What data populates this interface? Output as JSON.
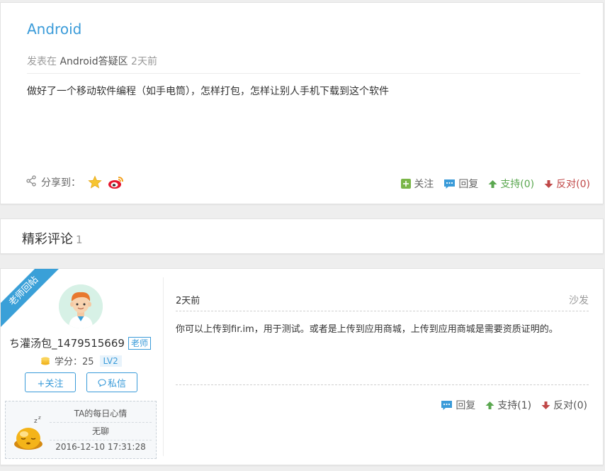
{
  "question": {
    "title": "Android",
    "meta_prefix": "发表在",
    "meta_category": "Android答疑区",
    "meta_time": "2天前",
    "body": "做好了一个移动软件编程（如手电筒），怎样打包，怎样让别人手机下载到这个软件",
    "share_label": "分享到：",
    "actions": {
      "follow": "关注",
      "reply": "回复",
      "support": "支持(0)",
      "oppose": "反对(0)"
    }
  },
  "comments_section": {
    "title": "精彩评论",
    "count": "1"
  },
  "comment": {
    "ribbon": "老师回帖",
    "username": "ち灌汤包_1479515669",
    "role_badge": "老师",
    "score_label": "学分：25",
    "level": "LV2",
    "follow_button": "+关注",
    "message_button": "私信",
    "mood": {
      "title": "TA的每日心情",
      "text": "无聊",
      "time": "2016-12-10 17:31:28"
    },
    "time": "2天前",
    "floor": "沙发",
    "text": "你可以上传到fir.im，用于测试。或者是上传到应用商城，上传到应用商城是需要资质证明的。",
    "actions": {
      "reply": "回复",
      "support": "支持(1)",
      "oppose": "反对(0)"
    }
  },
  "colors": {
    "accent": "#3a9bd9",
    "support": "#5aa74f",
    "oppose": "#c04848",
    "ribbon": "#3aa0d8"
  }
}
